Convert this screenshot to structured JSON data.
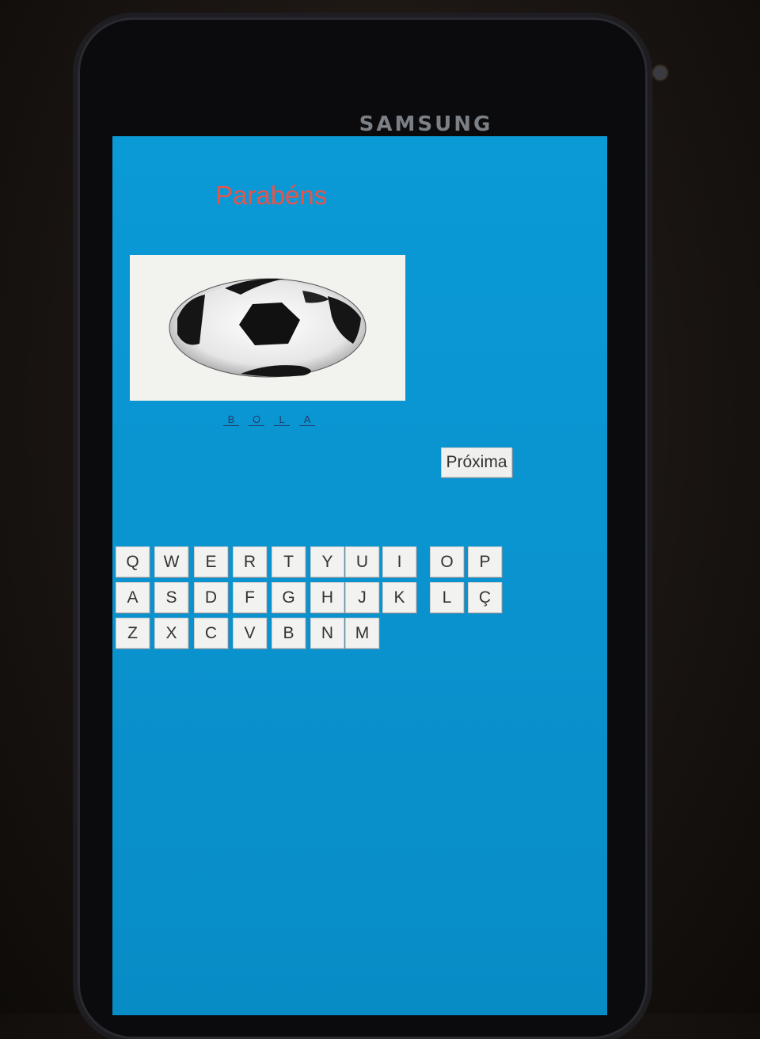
{
  "device": {
    "brand": "SAMSUNG"
  },
  "app": {
    "title": "Parabéns",
    "image_icon": "soccer-ball-image",
    "answer_letters": [
      "B",
      "O",
      "L",
      "A"
    ],
    "next_label": "Próxima"
  },
  "keyboard": {
    "row1": [
      "Q",
      "W",
      "E",
      "R",
      "T",
      "Y",
      "U",
      "I",
      "O",
      "P"
    ],
    "row2": [
      "A",
      "S",
      "D",
      "F",
      "G",
      "H",
      "J",
      "K",
      "L",
      "Ç"
    ],
    "row3": [
      "Z",
      "X",
      "C",
      "V",
      "B",
      "N",
      "M"
    ]
  },
  "colors": {
    "screen_bg": "#0a9ad6",
    "title": "#e8534a",
    "key_bg": "#f2f2f0"
  }
}
